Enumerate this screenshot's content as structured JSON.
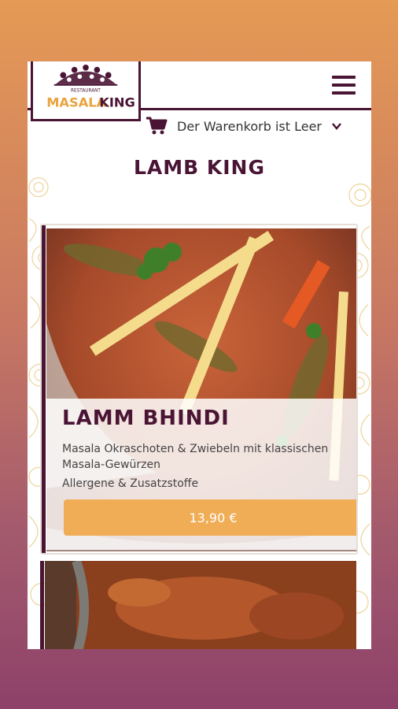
{
  "logo": {
    "tagline": "RESTAURANT",
    "name_left": "MASALA",
    "name_right": "KING"
  },
  "header": {
    "menu_icon": "hamburger-icon"
  },
  "cart": {
    "icon": "cart-icon",
    "text": "Der Warenkorb ist Leer",
    "chevron_icon": "chevron-down-icon"
  },
  "page": {
    "title": "LAMB KING"
  },
  "dish": {
    "name": "LAMM BHINDI",
    "description": "Masala Okraschoten & Zwiebeln mit klassischen Masala-Gewürzen",
    "allergen_link": "Allergene & Zusatzstoffe",
    "price": "13,90 €"
  },
  "colors": {
    "brand": "#4a1434",
    "accent": "#f0ad55",
    "gold": "#e8c77a"
  }
}
